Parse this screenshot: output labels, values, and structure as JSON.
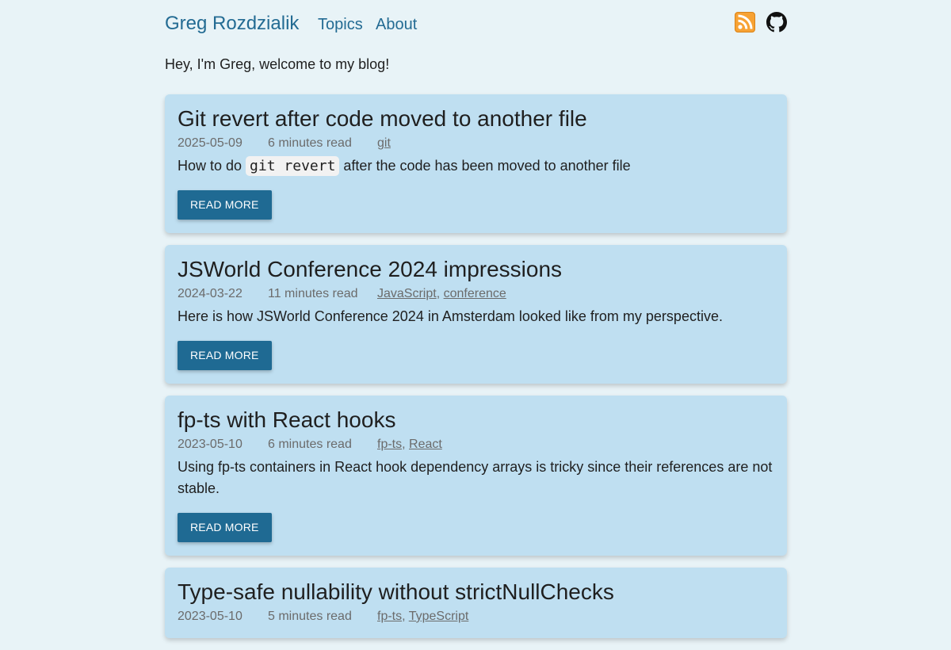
{
  "header": {
    "site_title": "Greg Rozdzialik",
    "nav": [
      {
        "label": "Topics"
      },
      {
        "label": "About"
      }
    ],
    "icons": [
      "rss-icon",
      "github-icon"
    ]
  },
  "intro": "Hey, I'm Greg, welcome to my blog!",
  "posts": [
    {
      "title": "Git revert after code moved to another file",
      "date": "2025-05-09",
      "read_time": "6 minutes read",
      "tags": [
        "git"
      ],
      "excerpt_before": "How to do ",
      "excerpt_code": "git revert",
      "excerpt_after": " after the code has been moved to another file",
      "button": "Read more"
    },
    {
      "title": "JSWorld Conference 2024 impressions",
      "date": "2024-03-22",
      "read_time": "11 minutes read",
      "tags": [
        "JavaScript",
        "conference"
      ],
      "excerpt": "Here is how JSWorld Conference 2024 in Amsterdam looked like from my perspective.",
      "button": "Read more"
    },
    {
      "title": "fp-ts with React hooks",
      "date": "2023-05-10",
      "read_time": "6 minutes read",
      "tags": [
        "fp-ts",
        "React"
      ],
      "excerpt": "Using fp-ts containers in React hook dependency arrays is tricky since their references are not stable.",
      "button": "Read more"
    },
    {
      "title": "Type-safe nullability without strictNullChecks",
      "date": "2023-05-10",
      "read_time": "5 minutes read",
      "tags": [
        "fp-ts",
        "TypeScript"
      ]
    }
  ],
  "colors": {
    "background": "#e8f3f7",
    "card": "#bfdff1",
    "link": "#236b93",
    "button": "#1f6a93",
    "rss": "#f7a234"
  }
}
